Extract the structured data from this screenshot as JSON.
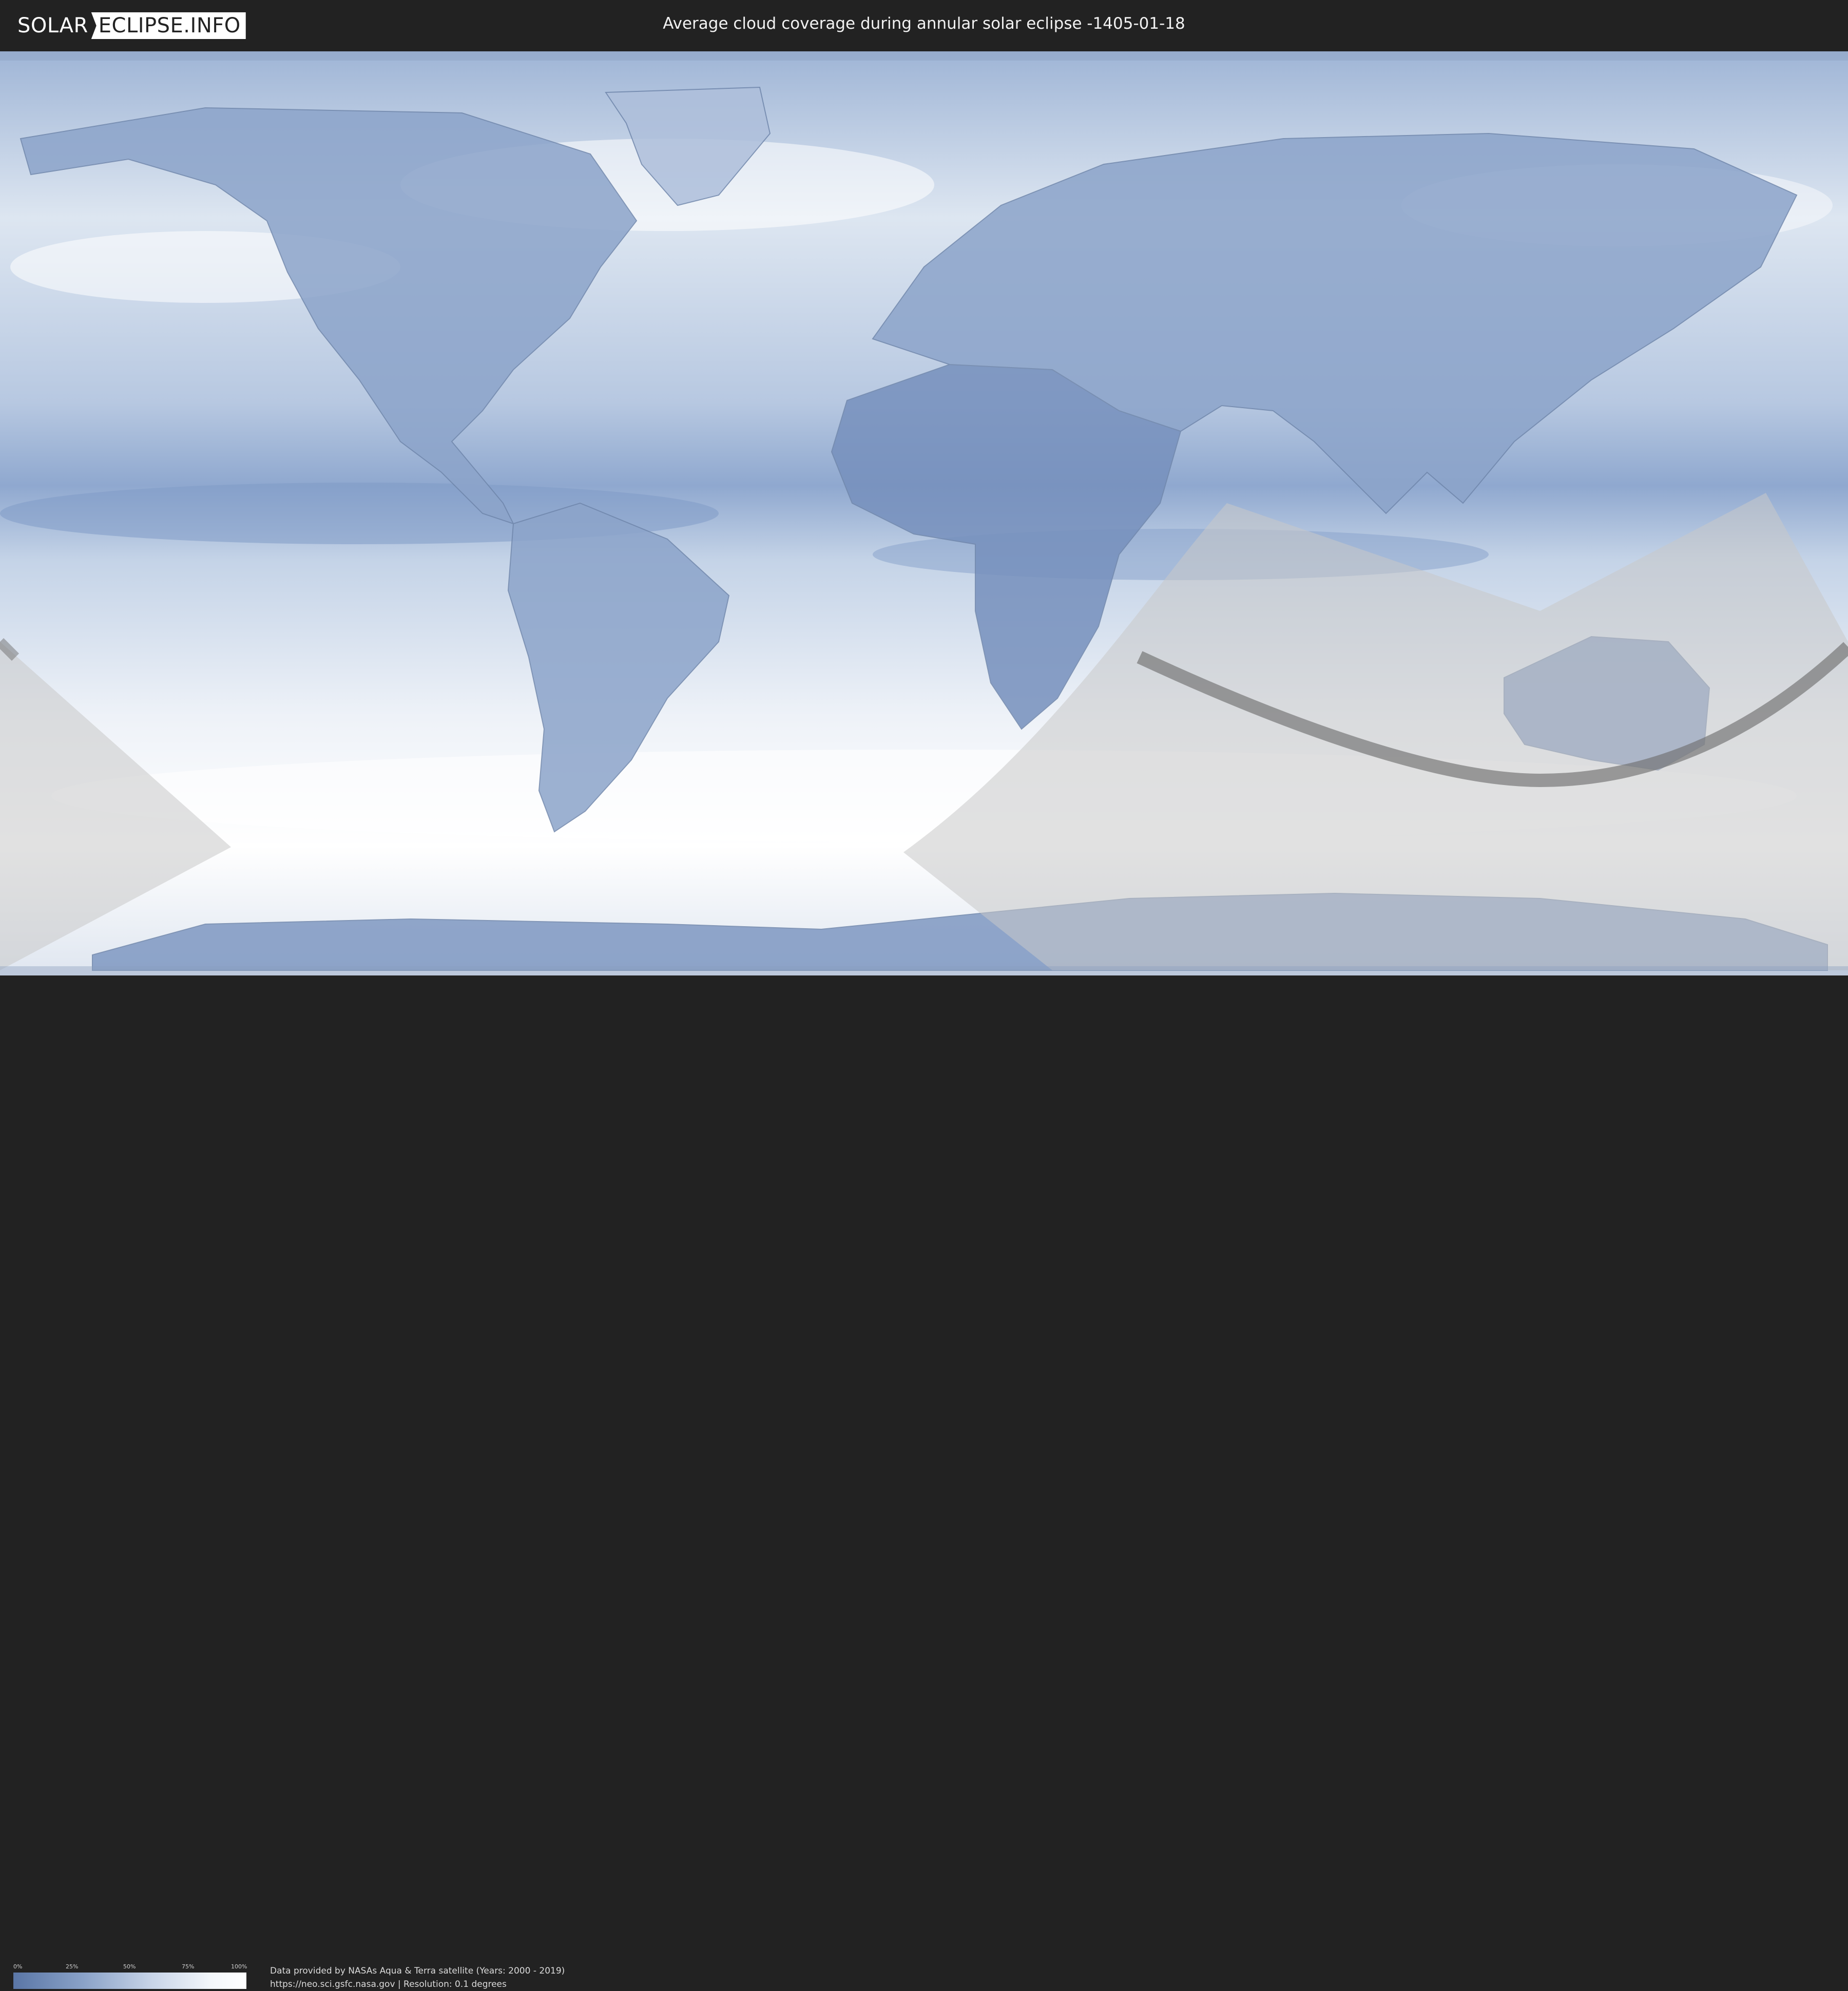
{
  "brand": {
    "part1": "SOLAR",
    "part2": "ECLIPSE.INFO"
  },
  "title": "Average cloud coverage during annular solar eclipse -1405-01-18",
  "legend": {
    "ticks": [
      "0%",
      "25%",
      "50%",
      "75%",
      "100%"
    ]
  },
  "credits": {
    "line1": "Data provided by NASAs Aqua & Terra satellite (Years: 2000 - 2019)",
    "line2": "https://neo.sci.gsfc.nasa.gov | Resolution: 0.1 degrees"
  },
  "colors": {
    "cloud_low": "#5a76a6",
    "cloud_high": "#ffffff",
    "shadow_zone": "#c8c8c8",
    "path": "#707070"
  }
}
